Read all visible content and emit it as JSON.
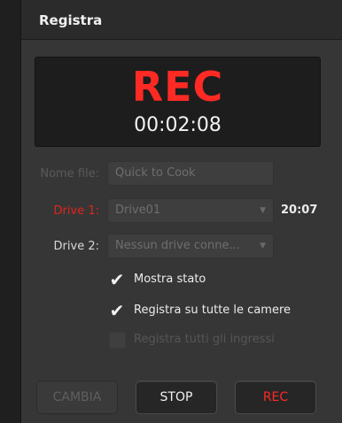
{
  "header": {
    "title": "Registra"
  },
  "display": {
    "status": "REC",
    "timecode": "00:02:08"
  },
  "form": {
    "filename": {
      "label": "Nome file:",
      "value": "Quick to Cook"
    },
    "drive1": {
      "label": "Drive 1:",
      "value": "Drive01",
      "remaining": "20:07"
    },
    "drive2": {
      "label": "Drive 2:",
      "value": "Nessun drive conne..."
    }
  },
  "options": [
    {
      "label": "Mostra stato",
      "checked": true,
      "enabled": true
    },
    {
      "label": "Registra su tutte le camere",
      "checked": true,
      "enabled": true
    },
    {
      "label": "Registra tutti gli ingressi",
      "checked": false,
      "enabled": false
    }
  ],
  "buttons": {
    "change": "CAMBIA",
    "stop": "STOP",
    "rec": "REC"
  },
  "colors": {
    "accent_red": "#ff2a24",
    "panel": "#363636",
    "text": "#f0f0f0",
    "disabled": "#5f5f5f"
  }
}
